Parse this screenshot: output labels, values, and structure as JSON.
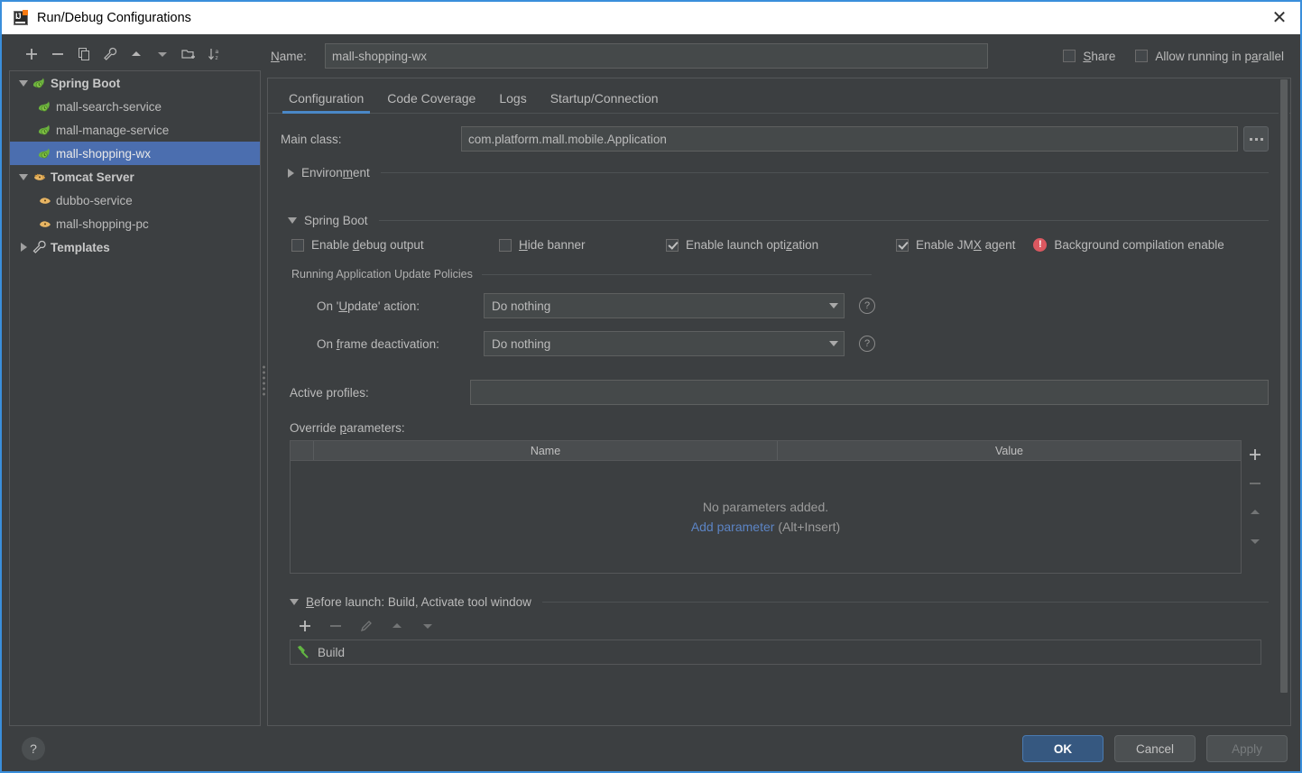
{
  "window": {
    "title": "Run/Debug Configurations",
    "app_icon": "intellij-idea-icon",
    "close_label": "✕"
  },
  "tree_toolbar": {
    "buttons": [
      {
        "name": "add-configuration-button",
        "icon": "plus-icon",
        "label": "+"
      },
      {
        "name": "remove-configuration-button",
        "icon": "minus-icon",
        "label": "−"
      },
      {
        "name": "copy-configuration-button",
        "icon": "copy-icon",
        "label": "copy"
      },
      {
        "name": "edit-templates-button",
        "icon": "wrench-icon",
        "label": "wrench"
      },
      {
        "name": "move-up-button",
        "icon": "arrow-up-icon",
        "label": "up"
      },
      {
        "name": "move-down-button",
        "icon": "arrow-down-icon",
        "label": "down"
      },
      {
        "name": "create-folder-button",
        "icon": "folder-add-icon",
        "label": "folder"
      },
      {
        "name": "sort-configurations-button",
        "icon": "sort-az-icon",
        "label": "sort"
      }
    ]
  },
  "tree": {
    "groups": [
      {
        "label": "Spring Boot",
        "icon": "spring-boot-icon",
        "expanded": true,
        "children": [
          {
            "label": "mall-search-service",
            "icon": "spring-boot-icon",
            "selected": false
          },
          {
            "label": "mall-manage-service",
            "icon": "spring-boot-icon",
            "selected": false
          },
          {
            "label": "mall-shopping-wx",
            "icon": "spring-boot-icon",
            "selected": true
          }
        ]
      },
      {
        "label": "Tomcat Server",
        "icon": "tomcat-icon",
        "expanded": true,
        "children": [
          {
            "label": "dubbo-service",
            "icon": "tomcat-icon",
            "selected": false
          },
          {
            "label": "mall-shopping-pc",
            "icon": "tomcat-icon",
            "selected": false
          }
        ]
      },
      {
        "label": "Templates",
        "icon": "wrench-icon",
        "expanded": false,
        "children": []
      }
    ]
  },
  "name_row": {
    "label": "Name:",
    "label_mnemonic": "N",
    "label_rest": "ame:",
    "value": "mall-shopping-wx",
    "share": {
      "label": "Share",
      "mnemonic": "S",
      "rest": "hare",
      "checked": false
    },
    "parallel": {
      "label": "Allow running in parallel",
      "pre": "Allow running in p",
      "mnemonic": "a",
      "rest": "rallel",
      "checked": false
    }
  },
  "tabs": [
    {
      "label": "Configuration",
      "active": true
    },
    {
      "label": "Code Coverage",
      "active": false
    },
    {
      "label": "Logs",
      "active": false
    },
    {
      "label": "Startup/Connection",
      "active": false
    }
  ],
  "configuration": {
    "main_class": {
      "label": "Main class:",
      "value": "com.platform.mall.mobile.Application",
      "browse_label": "..."
    },
    "environment_section": {
      "label": "Environment",
      "pre": "Environ",
      "mnemonic": "m",
      "rest": "ent",
      "expanded": false
    },
    "spring_boot_section": {
      "label": "Spring Boot",
      "pre": "Sprin",
      "mnemonic": "g",
      "rest": " Boot",
      "expanded": true,
      "checkboxes": [
        {
          "label": "Enable debug output",
          "pre": "Enable ",
          "mnemonic": "d",
          "rest": "ebug output",
          "checked": false
        },
        {
          "label": "Hide banner",
          "pre": "",
          "mnemonic": "H",
          "rest": "ide banner",
          "checked": false
        },
        {
          "label": "Enable launch optimization",
          "pre": "Enable launch opti",
          "mnemonic": "z",
          "rest": "ation",
          "checked": true
        },
        {
          "label": "Enable JMX agent",
          "pre": "Enable JM",
          "mnemonic": "X",
          "rest": " agent",
          "checked": true
        }
      ],
      "warning": {
        "icon": "error-icon",
        "text": "Background compilation enable"
      }
    },
    "update_policies": {
      "group_label": "Running Application Update Policies",
      "rows": [
        {
          "label": "On 'Update' action:",
          "pre": "On '",
          "mnemonic": "U",
          "rest": "pdate' action:",
          "value": "Do nothing",
          "help": "?"
        },
        {
          "label": "On frame deactivation:",
          "pre": "On ",
          "mnemonic": "f",
          "rest": "rame deactivation:",
          "value": "Do nothing",
          "help": "?"
        }
      ]
    },
    "active_profiles": {
      "label": "Active profiles:",
      "value": "",
      "placeholder": ""
    },
    "override_parameters": {
      "label": "Override parameters:",
      "pre": "Override ",
      "mnemonic": "p",
      "rest": "arameters:",
      "columns": [
        "Name",
        "Value"
      ],
      "rows": [],
      "empty_message": "No parameters added.",
      "empty_link": "Add parameter",
      "empty_hint": "(Alt+Insert)",
      "tools": [
        {
          "name": "add-parameter-button",
          "icon": "plus-icon",
          "enabled": true
        },
        {
          "name": "remove-parameter-button",
          "icon": "minus-icon",
          "enabled": false
        },
        {
          "name": "move-parameter-up-button",
          "icon": "arrow-up-icon",
          "enabled": false
        },
        {
          "name": "move-parameter-down-button",
          "icon": "arrow-down-icon",
          "enabled": false
        }
      ]
    },
    "before_launch": {
      "title": "Before launch: Build, Activate tool window",
      "pre": "",
      "mnemonic": "B",
      "rest": "efore launch: Build, Activate tool window",
      "expanded": true,
      "tools": [
        {
          "name": "add-task-button",
          "icon": "plus-icon",
          "enabled": true
        },
        {
          "name": "remove-task-button",
          "icon": "minus-icon",
          "enabled": false
        },
        {
          "name": "edit-task-button",
          "icon": "pencil-icon",
          "enabled": false
        },
        {
          "name": "task-move-up-button",
          "icon": "arrow-up-icon",
          "enabled": false
        },
        {
          "name": "task-move-down-button",
          "icon": "arrow-down-icon",
          "enabled": false
        }
      ],
      "tasks": [
        {
          "label": "Build",
          "icon": "hammer-icon"
        }
      ]
    }
  },
  "footer": {
    "help_label": "?",
    "ok_label": "OK",
    "cancel_label": "Cancel",
    "apply_label": "Apply",
    "apply_enabled": false
  },
  "colors": {
    "accent": "#4a88c7",
    "selection": "#4b6eaf",
    "primary_button": "#365880",
    "link": "#5c84c4",
    "error": "#db5860",
    "panel_bg": "#3c3f41",
    "field_bg": "#45494a"
  }
}
